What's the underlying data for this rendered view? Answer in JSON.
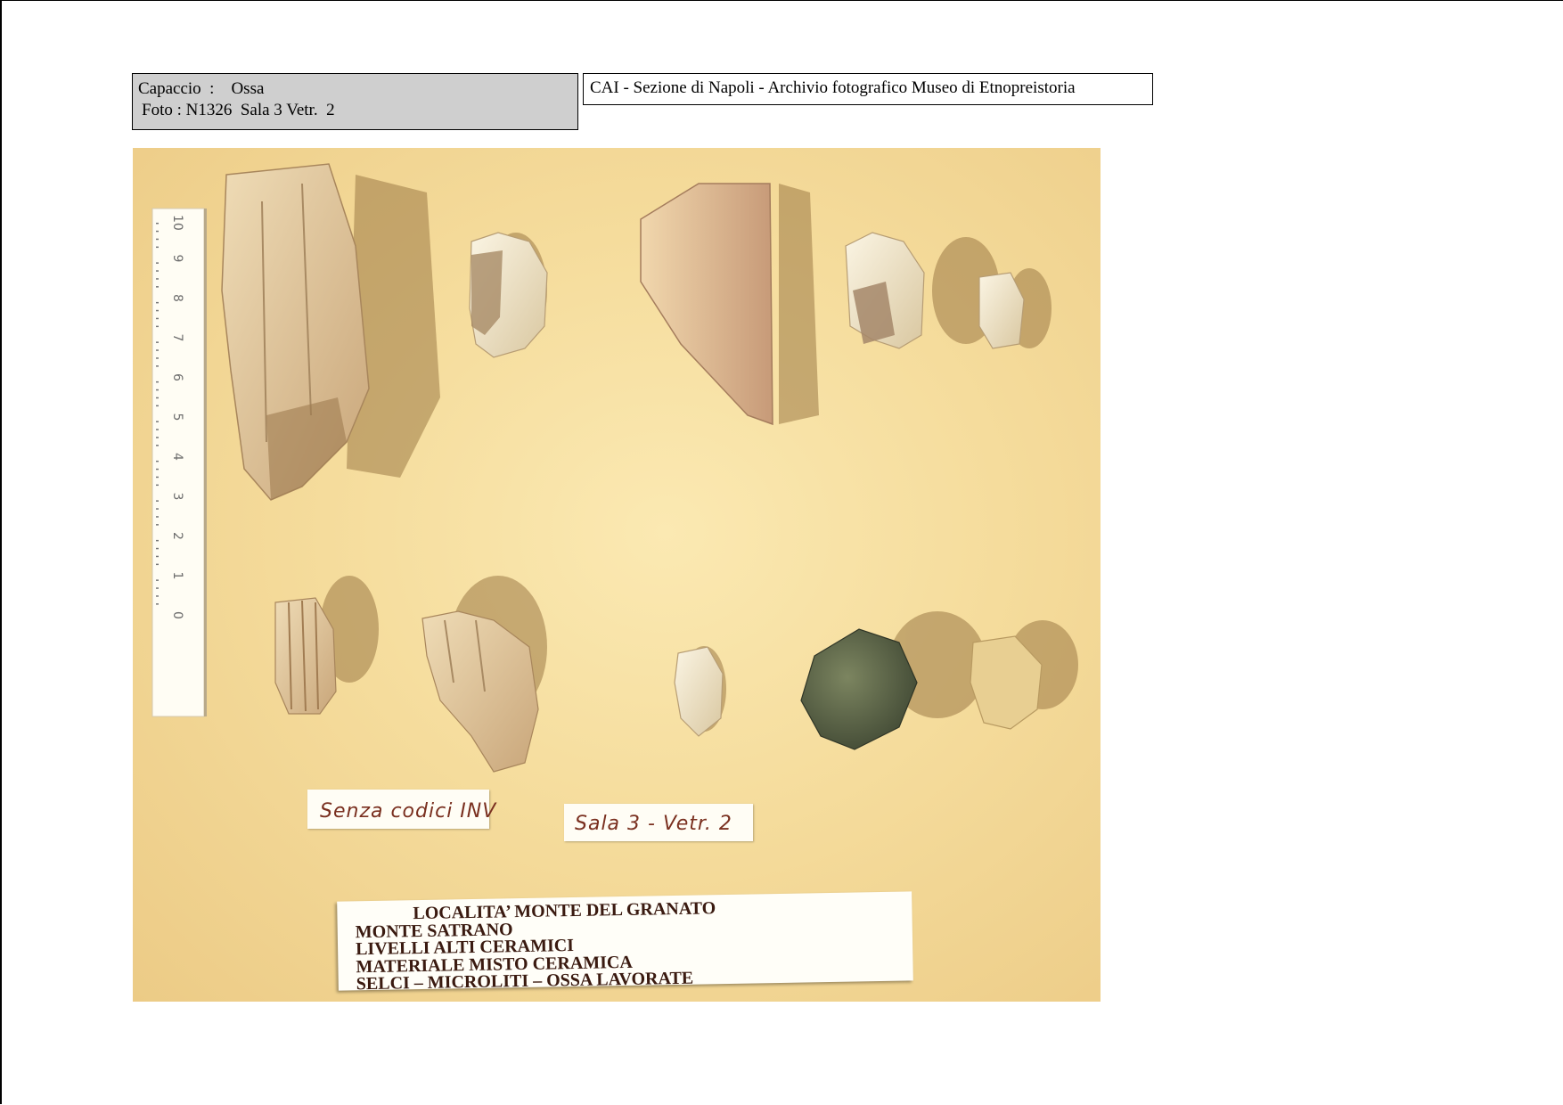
{
  "header": {
    "location_line": "Capaccio  :    Ossa",
    "photo_line": "Foto : N1326  Sala 3 Vetr.  2",
    "archive_title": "CAI - Sezione di Napoli  - Archivio fotografico Museo di Etnopreistoria"
  },
  "photo": {
    "ruler_numbers": [
      "0",
      "1",
      "2",
      "3",
      "4",
      "5",
      "6",
      "7",
      "8",
      "9",
      "10"
    ],
    "handwritten_labels": [
      "Senza codici INV",
      "Sala 3 - Vetr. 2"
    ],
    "display_card": {
      "lines": [
        "LOCALITA’ MONTE DEL GRANATO",
        "MONTE SATRANO",
        "LIVELLI ALTI CERAMICI",
        "MATERIALE MISTO CERAMICA",
        "SELCI – MICROLITI – OSSA LAVORATE"
      ]
    },
    "colors": {
      "background": "#f5dc9c",
      "bone": "#e8d0a4",
      "flint": "#5f6a4a"
    }
  }
}
